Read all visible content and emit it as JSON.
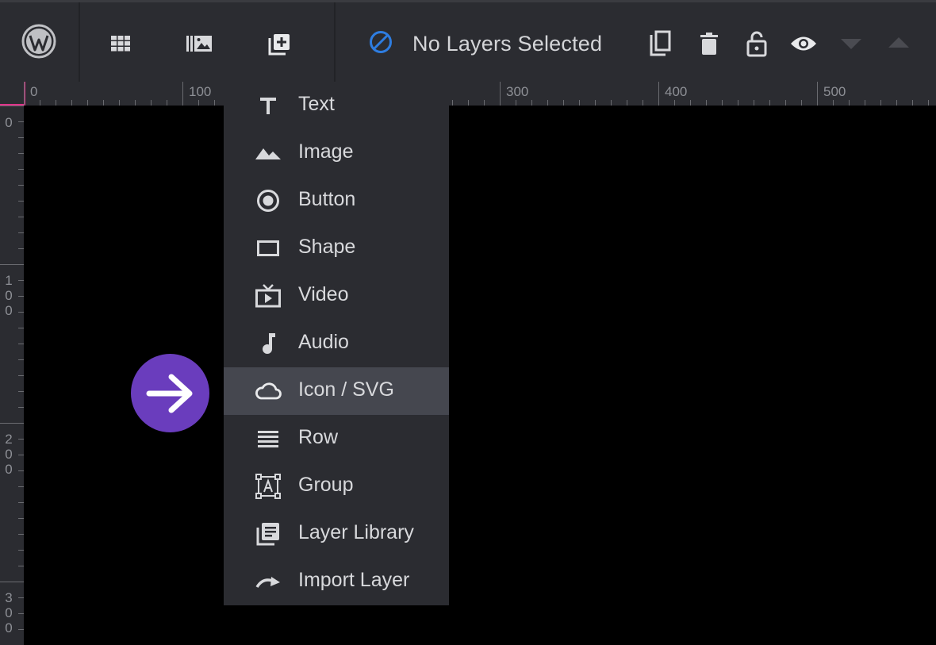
{
  "toolbar": {
    "buttons": [
      {
        "name": "wordpress-logo",
        "icon": "wordpress-icon"
      },
      {
        "name": "slides-grid-button",
        "icon": "grid-icon"
      },
      {
        "name": "media-library-button",
        "icon": "media-library-icon"
      },
      {
        "name": "add-layer-button",
        "icon": "add-layer-icon"
      }
    ],
    "status": {
      "icon": "no-selection-icon",
      "text": "No Layers Selected"
    },
    "actions": [
      {
        "name": "duplicate-button",
        "icon": "copy-icon"
      },
      {
        "name": "delete-button",
        "icon": "trash-icon"
      },
      {
        "name": "lock-button",
        "icon": "unlock-icon"
      },
      {
        "name": "visibility-button",
        "icon": "eye-icon"
      },
      {
        "name": "move-down-button",
        "icon": "caret-down-icon"
      },
      {
        "name": "move-up-button",
        "icon": "caret-up-icon"
      }
    ]
  },
  "ruler": {
    "horizontal_labels": [
      "0",
      "100",
      "300",
      "400",
      "500"
    ],
    "vertical_labels": [
      [
        "0"
      ],
      [
        "1",
        "0",
        "0"
      ],
      [
        "2",
        "0",
        "0"
      ],
      [
        "3",
        "0",
        "0"
      ]
    ]
  },
  "menu": {
    "items": [
      {
        "label": "Text",
        "icon": "text-icon"
      },
      {
        "label": "Image",
        "icon": "image-icon"
      },
      {
        "label": "Button",
        "icon": "button-icon"
      },
      {
        "label": "Shape",
        "icon": "shape-icon"
      },
      {
        "label": "Video",
        "icon": "video-icon"
      },
      {
        "label": "Audio",
        "icon": "audio-icon"
      },
      {
        "label": "Icon / SVG",
        "icon": "cloud-icon",
        "active": true
      },
      {
        "label": "Row",
        "icon": "row-icon"
      },
      {
        "label": "Group",
        "icon": "group-icon"
      },
      {
        "label": "Layer Library",
        "icon": "layer-library-icon"
      },
      {
        "label": "Import Layer",
        "icon": "import-icon"
      }
    ]
  },
  "colors": {
    "toolbar_bg": "#2b2c31",
    "menu_active": "#45474f",
    "accent_pink": "#e0338a",
    "status_icon_blue": "#2e7de1",
    "arrow_purple": "#6a3dbd"
  },
  "indicator": {
    "icon": "arrow-right-icon"
  }
}
